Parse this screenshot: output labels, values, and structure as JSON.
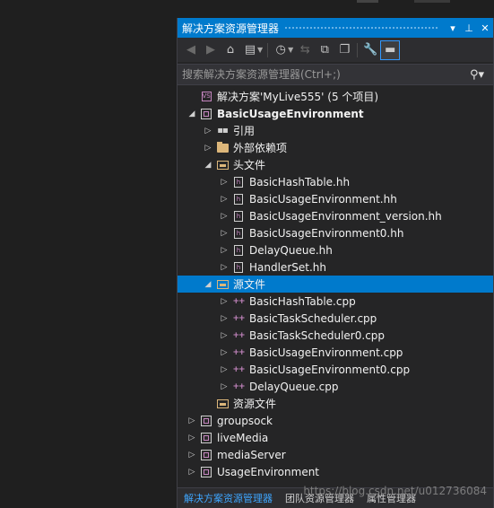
{
  "panel": {
    "title": "解决方案资源管理器",
    "search_placeholder": "搜索解决方案资源管理器(Ctrl+;)"
  },
  "tree": [
    {
      "label": "解决方案'MyLive555' (5 个项目)",
      "icon": "solution-icon",
      "level": 0,
      "arrow": "",
      "bold": false,
      "selected": false
    },
    {
      "label": "BasicUsageEnvironment",
      "icon": "project-icon",
      "level": 0,
      "arrow": "expanded",
      "bold": true,
      "selected": false
    },
    {
      "label": "引用",
      "icon": "references-icon",
      "level": 1,
      "arrow": "collapsed",
      "bold": false,
      "selected": false
    },
    {
      "label": "外部依赖项",
      "icon": "folder-icon",
      "level": 1,
      "arrow": "collapsed",
      "bold": false,
      "selected": false
    },
    {
      "label": "头文件",
      "icon": "filter-folder-icon",
      "level": 1,
      "arrow": "expanded",
      "bold": false,
      "selected": false
    },
    {
      "label": "BasicHashTable.hh",
      "icon": "header-file-icon",
      "level": 2,
      "arrow": "collapsed",
      "bold": false,
      "selected": false
    },
    {
      "label": "BasicUsageEnvironment.hh",
      "icon": "header-file-icon",
      "level": 2,
      "arrow": "collapsed",
      "bold": false,
      "selected": false
    },
    {
      "label": "BasicUsageEnvironment_version.hh",
      "icon": "header-file-icon",
      "level": 2,
      "arrow": "collapsed",
      "bold": false,
      "selected": false
    },
    {
      "label": "BasicUsageEnvironment0.hh",
      "icon": "header-file-icon",
      "level": 2,
      "arrow": "collapsed",
      "bold": false,
      "selected": false
    },
    {
      "label": "DelayQueue.hh",
      "icon": "header-file-icon",
      "level": 2,
      "arrow": "collapsed",
      "bold": false,
      "selected": false
    },
    {
      "label": "HandlerSet.hh",
      "icon": "header-file-icon",
      "level": 2,
      "arrow": "collapsed",
      "bold": false,
      "selected": false
    },
    {
      "label": "源文件",
      "icon": "filter-folder-icon",
      "level": 1,
      "arrow": "expanded",
      "bold": false,
      "selected": true
    },
    {
      "label": "BasicHashTable.cpp",
      "icon": "cpp-file-icon",
      "level": 2,
      "arrow": "collapsed",
      "bold": false,
      "selected": false
    },
    {
      "label": "BasicTaskScheduler.cpp",
      "icon": "cpp-file-icon",
      "level": 2,
      "arrow": "collapsed",
      "bold": false,
      "selected": false
    },
    {
      "label": "BasicTaskScheduler0.cpp",
      "icon": "cpp-file-icon",
      "level": 2,
      "arrow": "collapsed",
      "bold": false,
      "selected": false
    },
    {
      "label": "BasicUsageEnvironment.cpp",
      "icon": "cpp-file-icon",
      "level": 2,
      "arrow": "collapsed",
      "bold": false,
      "selected": false
    },
    {
      "label": "BasicUsageEnvironment0.cpp",
      "icon": "cpp-file-icon",
      "level": 2,
      "arrow": "collapsed",
      "bold": false,
      "selected": false
    },
    {
      "label": "DelayQueue.cpp",
      "icon": "cpp-file-icon",
      "level": 2,
      "arrow": "collapsed",
      "bold": false,
      "selected": false
    },
    {
      "label": "资源文件",
      "icon": "filter-folder-icon",
      "level": 1,
      "arrow": "",
      "bold": false,
      "selected": false
    },
    {
      "label": "groupsock",
      "icon": "project-icon",
      "level": 0,
      "arrow": "collapsed",
      "bold": false,
      "selected": false
    },
    {
      "label": "liveMedia",
      "icon": "project-icon",
      "level": 0,
      "arrow": "collapsed",
      "bold": false,
      "selected": false
    },
    {
      "label": "mediaServer",
      "icon": "project-icon",
      "level": 0,
      "arrow": "collapsed",
      "bold": false,
      "selected": false
    },
    {
      "label": "UsageEnvironment",
      "icon": "project-icon",
      "level": 0,
      "arrow": "collapsed",
      "bold": false,
      "selected": false
    }
  ],
  "footer": {
    "tabs": [
      "解决方案资源管理器",
      "团队资源管理器",
      "属性管理器"
    ]
  },
  "watermark": "https://blog.csdn.net/u012736084"
}
